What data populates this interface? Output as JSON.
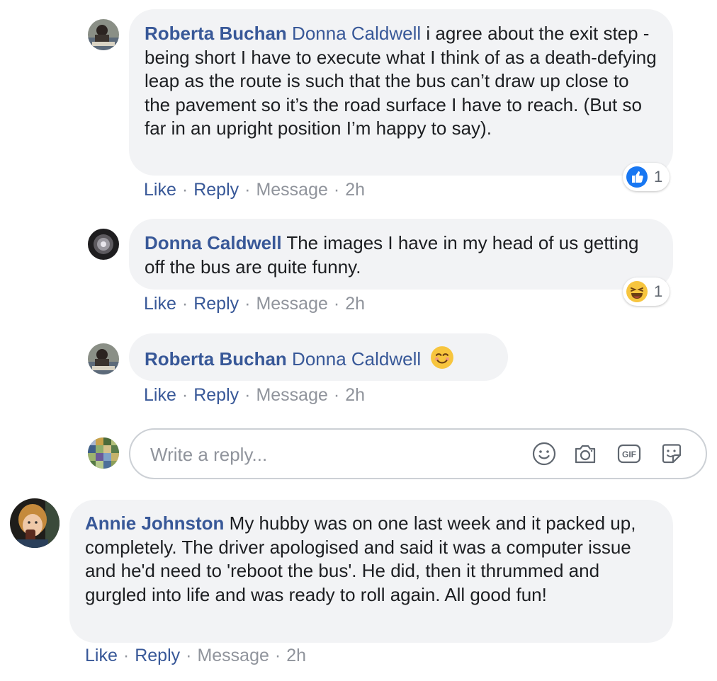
{
  "comments": [
    {
      "author": "Roberta Buchan",
      "mention": "Donna Caldwell",
      "text": " i agree about the exit step - being short I have to execute what I think of as a death-defying leap as the route is such that the bus can’t draw up close to the pavement so it’s the road surface I have to reach. (But so far in an upright position I’m happy to say).",
      "reaction": {
        "icon": "like-icon",
        "count": "1"
      },
      "actions": {
        "like": "Like",
        "reply": "Reply",
        "message": "Message",
        "time": "2h"
      }
    },
    {
      "author": "Donna Caldwell",
      "text": " The images I have in my head of us getting off the bus are quite funny.",
      "reaction": {
        "icon": "haha-icon",
        "count": "1"
      },
      "actions": {
        "like": "Like",
        "reply": "Reply",
        "message": "Message",
        "time": "2h"
      }
    },
    {
      "author": "Roberta Buchan",
      "mention": "Donna Caldwell",
      "emoji": "smiling-face-emoji",
      "actions": {
        "like": "Like",
        "reply": "Reply",
        "message": "Message",
        "time": "2h"
      }
    },
    {
      "author": "Annie Johnston",
      "text": " My hubby was on one last week and it packed up, completely. The driver apologised and said it was a computer issue and he'd need to 'reboot the bus'. He did, then it thrummed and gurgled into life and was ready to roll again. All good fun!",
      "actions": {
        "like": "Like",
        "reply": "Reply",
        "message": "Message",
        "time": "2h"
      }
    }
  ],
  "reply_box": {
    "placeholder": "Write a reply...",
    "icons": [
      "emoji-icon",
      "camera-icon",
      "gif-icon",
      "sticker-icon"
    ],
    "gif_label": "GIF"
  },
  "colors": {
    "link": "#385898",
    "bubble": "#f2f3f5",
    "meta": "#90949c",
    "like_blue": "#1877f2"
  }
}
